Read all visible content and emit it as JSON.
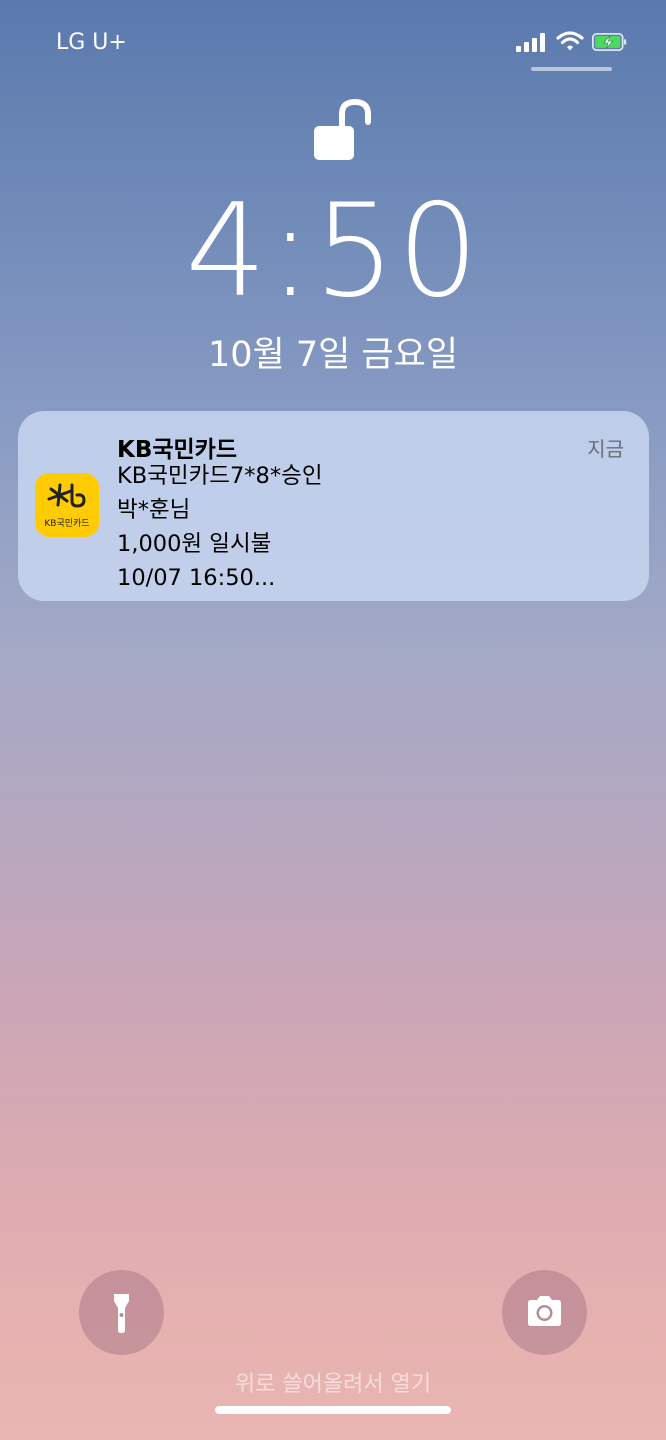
{
  "status_bar": {
    "carrier": "LG U+",
    "signal_bars": 4,
    "wifi": true,
    "battery_charging": true,
    "icons": [
      "cellular-signal-icon",
      "wifi-icon",
      "battery-charging-icon"
    ]
  },
  "lock_screen": {
    "lock_state": "unlocked",
    "time": "4:50",
    "date": "10월 7일 금요일"
  },
  "notification": {
    "app_icon": "kb-kookmin-card-icon",
    "app_icon_label": "KB국민카드",
    "title": "KB국민카드",
    "time": "지금",
    "lines": [
      "KB국민카드7*8*승인",
      "박*훈님",
      "1,000원 일시불",
      "10/07 16:50..."
    ]
  },
  "bottom": {
    "left_button_icon": "flashlight-icon",
    "right_button_icon": "camera-icon",
    "hint": "위로 쓸어올려서 열기"
  },
  "colors": {
    "app_icon_bg": "#ffcb05",
    "notification_bg": "#c9d8f2"
  }
}
